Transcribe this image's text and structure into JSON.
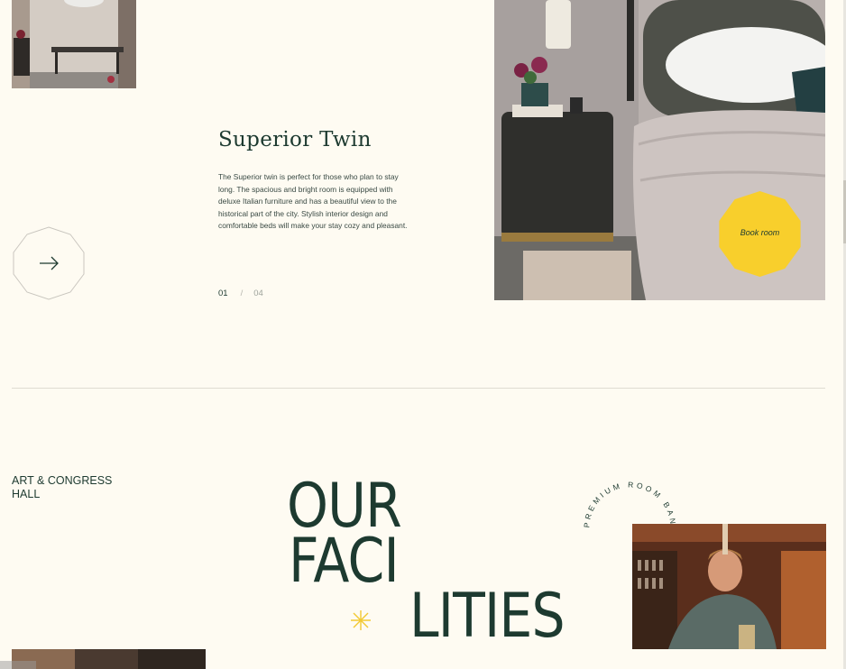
{
  "room": {
    "title": "Superior Twin",
    "description": "The Superior twin is perfect for those who plan to stay long. The spacious and bright room is equipped with deluxe Italian furniture and has a beautiful view to the historical part of the city. Stylish interior design and comfortable beds will make your stay cozy and pleasant.",
    "book_label": "Book room",
    "book_color": "#f8cf2c"
  },
  "pager": {
    "current": "01",
    "separator": "/",
    "total": "04"
  },
  "facilities": {
    "side_label": "ART & CONGRESS HALL",
    "heading_line1": "OUR",
    "heading_line2": "FACI",
    "heading_line3": "LITIES",
    "badge_text": "PREMIUM ROOM BANK HOTEL"
  },
  "icons": {
    "next": "arrow-right-icon",
    "star": "sparkle-star-icon"
  },
  "colors": {
    "background": "#fefbf2",
    "text": "#1d3a30",
    "accent": "#f8cf2c"
  }
}
